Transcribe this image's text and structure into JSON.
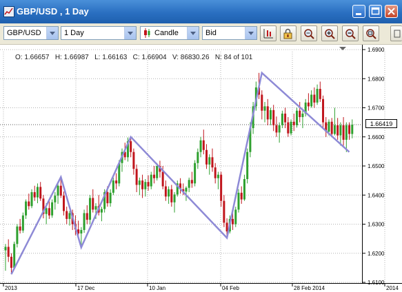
{
  "window": {
    "title": "GBP/USD , 1 Day"
  },
  "toolbar": {
    "symbol": "GBP/USD",
    "period": "1 Day",
    "chart_type": "Candle",
    "price_side": "Bid",
    "buttons": [
      "bar-chart-icon",
      "lock-icon",
      "zoom-fit-icon",
      "zoom-in-icon",
      "zoom-out-icon",
      "zoom-reset-icon"
    ]
  },
  "info": {
    "text": "O: 1.66657   H: 1.66987   L: 1.66163   C: 1.66904   V: 86830.26   N: 84 of 101"
  },
  "colors": {
    "up": "#2ea02e",
    "down": "#c0151c",
    "zigzag": "#8e8ad6",
    "titlebar": "#2a6fc1",
    "toolbar": "#ece9d8"
  },
  "chart_data": {
    "type": "candlestick",
    "ylim": [
      1.61,
      1.69
    ],
    "ytick_labels": [
      "1.6900",
      "1.6800",
      "1.6700",
      "1.6600",
      "1.6500",
      "1.6400",
      "1.6300",
      "1.6200",
      "1.6100"
    ],
    "yticks": [
      1.69,
      1.68,
      1.67,
      1.66,
      1.65,
      1.64,
      1.63,
      1.62,
      1.61
    ],
    "xtick_labels": [
      "2013",
      "17 Dec",
      "10 Jan",
      "04 Feb",
      "28 Feb 2014",
      "2014"
    ],
    "current_price": "1.66419",
    "zigzag": [
      {
        "bar": 2,
        "value": 1.6128
      },
      {
        "bar": 19,
        "value": 1.6462
      },
      {
        "bar": 26,
        "value": 1.622
      },
      {
        "bar": 43,
        "value": 1.66
      },
      {
        "bar": 76,
        "value": 1.6253
      },
      {
        "bar": 88,
        "value": 1.682
      },
      {
        "bar": 118,
        "value": 1.6548
      }
    ],
    "candles": [
      {
        "o": 1.621,
        "h": 1.6232,
        "l": 1.614,
        "c": 1.6222
      },
      {
        "o": 1.6222,
        "h": 1.6248,
        "l": 1.617,
        "c": 1.6188
      },
      {
        "o": 1.6188,
        "h": 1.62,
        "l": 1.6128,
        "c": 1.615
      },
      {
        "o": 1.615,
        "h": 1.624,
        "l": 1.6148,
        "c": 1.6232
      },
      {
        "o": 1.6232,
        "h": 1.63,
        "l": 1.622,
        "c": 1.6292
      },
      {
        "o": 1.6292,
        "h": 1.6318,
        "l": 1.6268,
        "c": 1.6278
      },
      {
        "o": 1.6278,
        "h": 1.634,
        "l": 1.627,
        "c": 1.633
      },
      {
        "o": 1.633,
        "h": 1.6385,
        "l": 1.6318,
        "c": 1.6378
      },
      {
        "o": 1.6378,
        "h": 1.6405,
        "l": 1.635,
        "c": 1.6362
      },
      {
        "o": 1.6362,
        "h": 1.642,
        "l": 1.6355,
        "c": 1.641
      },
      {
        "o": 1.641,
        "h": 1.6432,
        "l": 1.638,
        "c": 1.6392
      },
      {
        "o": 1.6392,
        "h": 1.644,
        "l": 1.6372,
        "c": 1.6428
      },
      {
        "o": 1.6428,
        "h": 1.6445,
        "l": 1.638,
        "c": 1.6388
      },
      {
        "o": 1.6388,
        "h": 1.64,
        "l": 1.632,
        "c": 1.6335
      },
      {
        "o": 1.6335,
        "h": 1.6372,
        "l": 1.63,
        "c": 1.6355
      },
      {
        "o": 1.6355,
        "h": 1.638,
        "l": 1.6318,
        "c": 1.633
      },
      {
        "o": 1.633,
        "h": 1.6385,
        "l": 1.6322,
        "c": 1.6375
      },
      {
        "o": 1.6375,
        "h": 1.641,
        "l": 1.635,
        "c": 1.6398
      },
      {
        "o": 1.6398,
        "h": 1.644,
        "l": 1.637,
        "c": 1.6432
      },
      {
        "o": 1.6432,
        "h": 1.6462,
        "l": 1.639,
        "c": 1.6398
      },
      {
        "o": 1.6398,
        "h": 1.6412,
        "l": 1.633,
        "c": 1.6345
      },
      {
        "o": 1.6345,
        "h": 1.636,
        "l": 1.63,
        "c": 1.6318
      },
      {
        "o": 1.6318,
        "h": 1.6345,
        "l": 1.6295,
        "c": 1.6338
      },
      {
        "o": 1.6338,
        "h": 1.635,
        "l": 1.628,
        "c": 1.63
      },
      {
        "o": 1.63,
        "h": 1.633,
        "l": 1.6262,
        "c": 1.6282
      },
      {
        "o": 1.6282,
        "h": 1.6312,
        "l": 1.625,
        "c": 1.6268
      },
      {
        "o": 1.6268,
        "h": 1.629,
        "l": 1.622,
        "c": 1.628
      },
      {
        "o": 1.628,
        "h": 1.635,
        "l": 1.627,
        "c": 1.6338
      },
      {
        "o": 1.6338,
        "h": 1.6365,
        "l": 1.63,
        "c": 1.6315
      },
      {
        "o": 1.6315,
        "h": 1.64,
        "l": 1.63,
        "c": 1.639
      },
      {
        "o": 1.639,
        "h": 1.642,
        "l": 1.634,
        "c": 1.635
      },
      {
        "o": 1.635,
        "h": 1.6372,
        "l": 1.6318,
        "c": 1.6362
      },
      {
        "o": 1.6362,
        "h": 1.64,
        "l": 1.633,
        "c": 1.634
      },
      {
        "o": 1.634,
        "h": 1.636,
        "l": 1.631,
        "c": 1.6352
      },
      {
        "o": 1.6352,
        "h": 1.642,
        "l": 1.634,
        "c": 1.641
      },
      {
        "o": 1.641,
        "h": 1.643,
        "l": 1.636,
        "c": 1.6372
      },
      {
        "o": 1.6372,
        "h": 1.642,
        "l": 1.636,
        "c": 1.6408
      },
      {
        "o": 1.6408,
        "h": 1.646,
        "l": 1.64,
        "c": 1.645
      },
      {
        "o": 1.645,
        "h": 1.6475,
        "l": 1.642,
        "c": 1.644
      },
      {
        "o": 1.644,
        "h": 1.652,
        "l": 1.643,
        "c": 1.651
      },
      {
        "o": 1.651,
        "h": 1.656,
        "l": 1.648,
        "c": 1.6548
      },
      {
        "o": 1.6548,
        "h": 1.658,
        "l": 1.652,
        "c": 1.653
      },
      {
        "o": 1.653,
        "h": 1.6598,
        "l": 1.6515,
        "c": 1.6585
      },
      {
        "o": 1.6585,
        "h": 1.66,
        "l": 1.653,
        "c": 1.6548
      },
      {
        "o": 1.6548,
        "h": 1.656,
        "l": 1.647,
        "c": 1.649
      },
      {
        "o": 1.649,
        "h": 1.6505,
        "l": 1.641,
        "c": 1.6435
      },
      {
        "o": 1.6435,
        "h": 1.646,
        "l": 1.64,
        "c": 1.645
      },
      {
        "o": 1.645,
        "h": 1.647,
        "l": 1.639,
        "c": 1.642
      },
      {
        "o": 1.642,
        "h": 1.6455,
        "l": 1.6395,
        "c": 1.6445
      },
      {
        "o": 1.6445,
        "h": 1.6468,
        "l": 1.6415,
        "c": 1.643
      },
      {
        "o": 1.643,
        "h": 1.648,
        "l": 1.642,
        "c": 1.647
      },
      {
        "o": 1.647,
        "h": 1.65,
        "l": 1.644,
        "c": 1.6458
      },
      {
        "o": 1.6458,
        "h": 1.651,
        "l": 1.645,
        "c": 1.65
      },
      {
        "o": 1.65,
        "h": 1.6518,
        "l": 1.646,
        "c": 1.648
      },
      {
        "o": 1.648,
        "h": 1.65,
        "l": 1.642,
        "c": 1.643
      },
      {
        "o": 1.643,
        "h": 1.645,
        "l": 1.638,
        "c": 1.6395
      },
      {
        "o": 1.6395,
        "h": 1.643,
        "l": 1.637,
        "c": 1.642
      },
      {
        "o": 1.642,
        "h": 1.6435,
        "l": 1.636,
        "c": 1.6375
      },
      {
        "o": 1.6375,
        "h": 1.641,
        "l": 1.634,
        "c": 1.6402
      },
      {
        "o": 1.6402,
        "h": 1.645,
        "l": 1.6395,
        "c": 1.644
      },
      {
        "o": 1.644,
        "h": 1.6458,
        "l": 1.6405,
        "c": 1.642
      },
      {
        "o": 1.642,
        "h": 1.644,
        "l": 1.64,
        "c": 1.6412
      },
      {
        "o": 1.6412,
        "h": 1.643,
        "l": 1.638,
        "c": 1.6425
      },
      {
        "o": 1.6425,
        "h": 1.646,
        "l": 1.641,
        "c": 1.6452
      },
      {
        "o": 1.6452,
        "h": 1.648,
        "l": 1.6425,
        "c": 1.644
      },
      {
        "o": 1.644,
        "h": 1.652,
        "l": 1.643,
        "c": 1.651
      },
      {
        "o": 1.651,
        "h": 1.656,
        "l": 1.649,
        "c": 1.6548
      },
      {
        "o": 1.6548,
        "h": 1.66,
        "l": 1.653,
        "c": 1.6588
      },
      {
        "o": 1.6588,
        "h": 1.6625,
        "l": 1.654,
        "c": 1.6555
      },
      {
        "o": 1.6555,
        "h": 1.6575,
        "l": 1.649,
        "c": 1.6505
      },
      {
        "o": 1.6505,
        "h": 1.654,
        "l": 1.647,
        "c": 1.653
      },
      {
        "o": 1.653,
        "h": 1.656,
        "l": 1.648,
        "c": 1.6495
      },
      {
        "o": 1.6495,
        "h": 1.651,
        "l": 1.644,
        "c": 1.6458
      },
      {
        "o": 1.6458,
        "h": 1.648,
        "l": 1.642,
        "c": 1.647
      },
      {
        "o": 1.647,
        "h": 1.648,
        "l": 1.636,
        "c": 1.638
      },
      {
        "o": 1.638,
        "h": 1.64,
        "l": 1.629,
        "c": 1.6305
      },
      {
        "o": 1.6305,
        "h": 1.632,
        "l": 1.6253,
        "c": 1.6275
      },
      {
        "o": 1.6275,
        "h": 1.633,
        "l": 1.6268,
        "c": 1.6318
      },
      {
        "o": 1.6318,
        "h": 1.634,
        "l": 1.628,
        "c": 1.63
      },
      {
        "o": 1.63,
        "h": 1.636,
        "l": 1.629,
        "c": 1.635
      },
      {
        "o": 1.635,
        "h": 1.642,
        "l": 1.634,
        "c": 1.6408
      },
      {
        "o": 1.6408,
        "h": 1.643,
        "l": 1.637,
        "c": 1.6385
      },
      {
        "o": 1.6385,
        "h": 1.647,
        "l": 1.638,
        "c": 1.6455
      },
      {
        "o": 1.6455,
        "h": 1.656,
        "l": 1.644,
        "c": 1.6548
      },
      {
        "o": 1.6548,
        "h": 1.665,
        "l": 1.653,
        "c": 1.663
      },
      {
        "o": 1.663,
        "h": 1.672,
        "l": 1.661,
        "c": 1.6705
      },
      {
        "o": 1.6705,
        "h": 1.679,
        "l": 1.669,
        "c": 1.677
      },
      {
        "o": 1.677,
        "h": 1.682,
        "l": 1.673,
        "c": 1.6745
      },
      {
        "o": 1.6745,
        "h": 1.676,
        "l": 1.666,
        "c": 1.669
      },
      {
        "o": 1.669,
        "h": 1.672,
        "l": 1.665,
        "c": 1.6705
      },
      {
        "o": 1.6705,
        "h": 1.673,
        "l": 1.664,
        "c": 1.666
      },
      {
        "o": 1.666,
        "h": 1.67,
        "l": 1.664,
        "c": 1.6692
      },
      {
        "o": 1.6692,
        "h": 1.671,
        "l": 1.662,
        "c": 1.664
      },
      {
        "o": 1.664,
        "h": 1.667,
        "l": 1.66,
        "c": 1.6615
      },
      {
        "o": 1.6615,
        "h": 1.665,
        "l": 1.658,
        "c": 1.664
      },
      {
        "o": 1.664,
        "h": 1.669,
        "l": 1.663,
        "c": 1.668
      },
      {
        "o": 1.668,
        "h": 1.67,
        "l": 1.663,
        "c": 1.665
      },
      {
        "o": 1.665,
        "h": 1.6668,
        "l": 1.66,
        "c": 1.6612
      },
      {
        "o": 1.6612,
        "h": 1.666,
        "l": 1.6605,
        "c": 1.6652
      },
      {
        "o": 1.6652,
        "h": 1.668,
        "l": 1.662,
        "c": 1.664
      },
      {
        "o": 1.664,
        "h": 1.67,
        "l": 1.6632,
        "c": 1.669
      },
      {
        "o": 1.669,
        "h": 1.672,
        "l": 1.665,
        "c": 1.6668
      },
      {
        "o": 1.6668,
        "h": 1.669,
        "l": 1.663,
        "c": 1.668
      },
      {
        "o": 1.668,
        "h": 1.673,
        "l": 1.667,
        "c": 1.6718
      },
      {
        "o": 1.6718,
        "h": 1.675,
        "l": 1.669,
        "c": 1.6705
      },
      {
        "o": 1.6705,
        "h": 1.676,
        "l": 1.67,
        "c": 1.6745
      },
      {
        "o": 1.6745,
        "h": 1.677,
        "l": 1.67,
        "c": 1.6718
      },
      {
        "o": 1.6718,
        "h": 1.678,
        "l": 1.671,
        "c": 1.6765
      },
      {
        "o": 1.6765,
        "h": 1.679,
        "l": 1.672,
        "c": 1.673
      },
      {
        "o": 1.673,
        "h": 1.6742,
        "l": 1.663,
        "c": 1.665
      },
      {
        "o": 1.665,
        "h": 1.6668,
        "l": 1.66,
        "c": 1.6618
      },
      {
        "o": 1.6618,
        "h": 1.666,
        "l": 1.6605,
        "c": 1.6652
      },
      {
        "o": 1.6652,
        "h": 1.6665,
        "l": 1.66,
        "c": 1.661
      },
      {
        "o": 1.661,
        "h": 1.67,
        "l": 1.6605,
        "c": 1.664
      },
      {
        "o": 1.664,
        "h": 1.6665,
        "l": 1.659,
        "c": 1.6605
      },
      {
        "o": 1.6605,
        "h": 1.665,
        "l": 1.657,
        "c": 1.664
      },
      {
        "o": 1.664,
        "h": 1.6668,
        "l": 1.657,
        "c": 1.659
      },
      {
        "o": 1.659,
        "h": 1.665,
        "l": 1.6548,
        "c": 1.664
      },
      {
        "o": 1.664,
        "h": 1.665,
        "l": 1.659,
        "c": 1.661
      },
      {
        "o": 1.661,
        "h": 1.666,
        "l": 1.6595,
        "c": 1.6642
      }
    ]
  }
}
